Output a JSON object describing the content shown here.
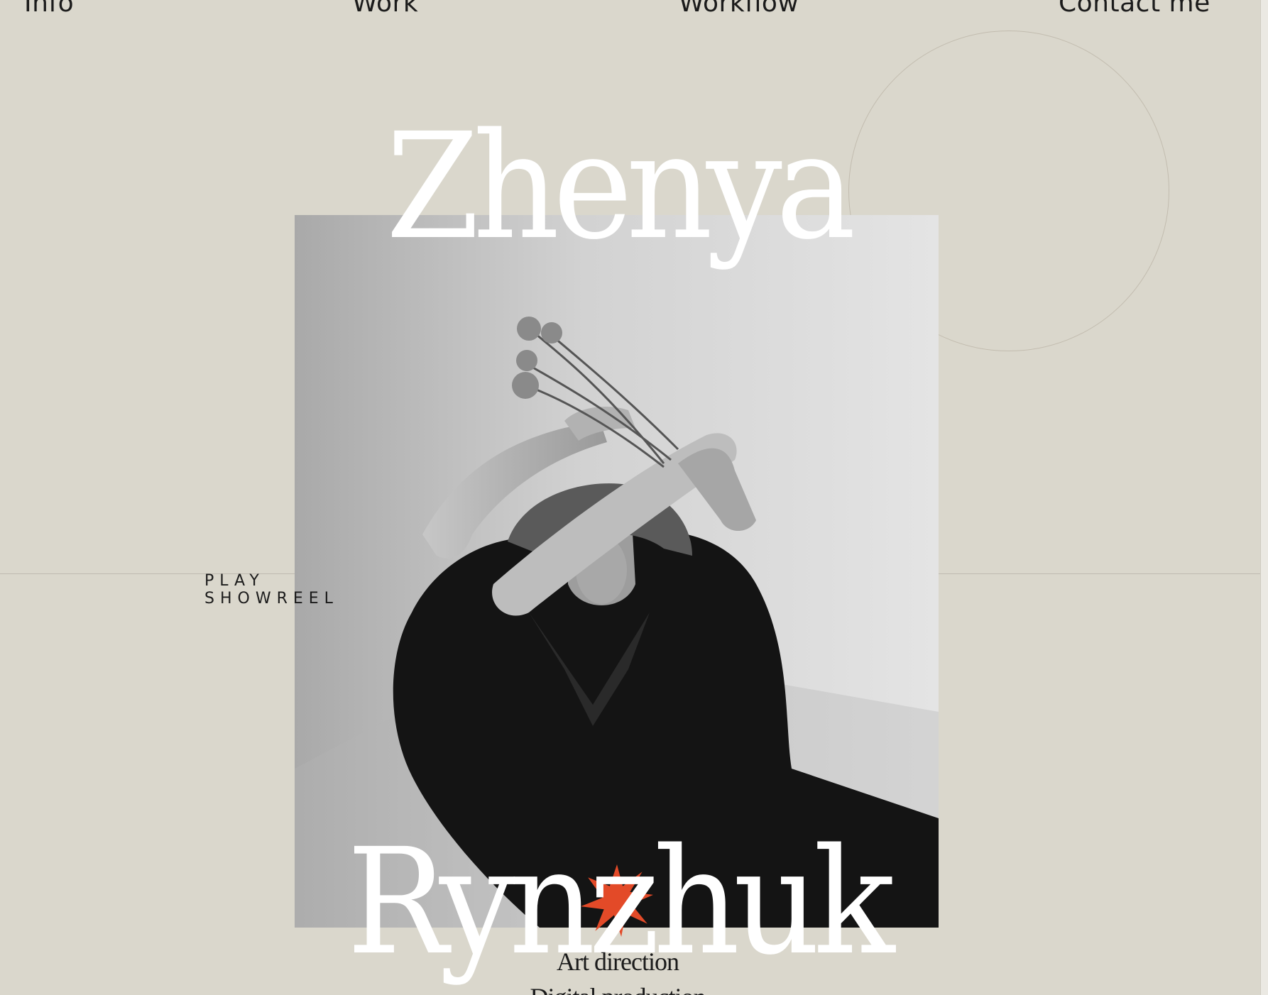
{
  "nav": {
    "items": [
      {
        "label": "Info"
      },
      {
        "label": "Work"
      },
      {
        "label": "Workflow"
      },
      {
        "label": "Contact me"
      }
    ]
  },
  "hero": {
    "first_name": "Zhenya",
    "last_name": "Rynzhuk",
    "showreel": {
      "line1": "PLAY",
      "line2": "SHOWREEL"
    },
    "services": [
      "Art direction",
      "Digital production"
    ]
  },
  "colors": {
    "background": "#dad7cc",
    "accent_star": "#e34a28",
    "name_text": "#ffffff",
    "nav_text": "#1b1b1b"
  },
  "icons": {
    "star": "orange-star-icon"
  }
}
